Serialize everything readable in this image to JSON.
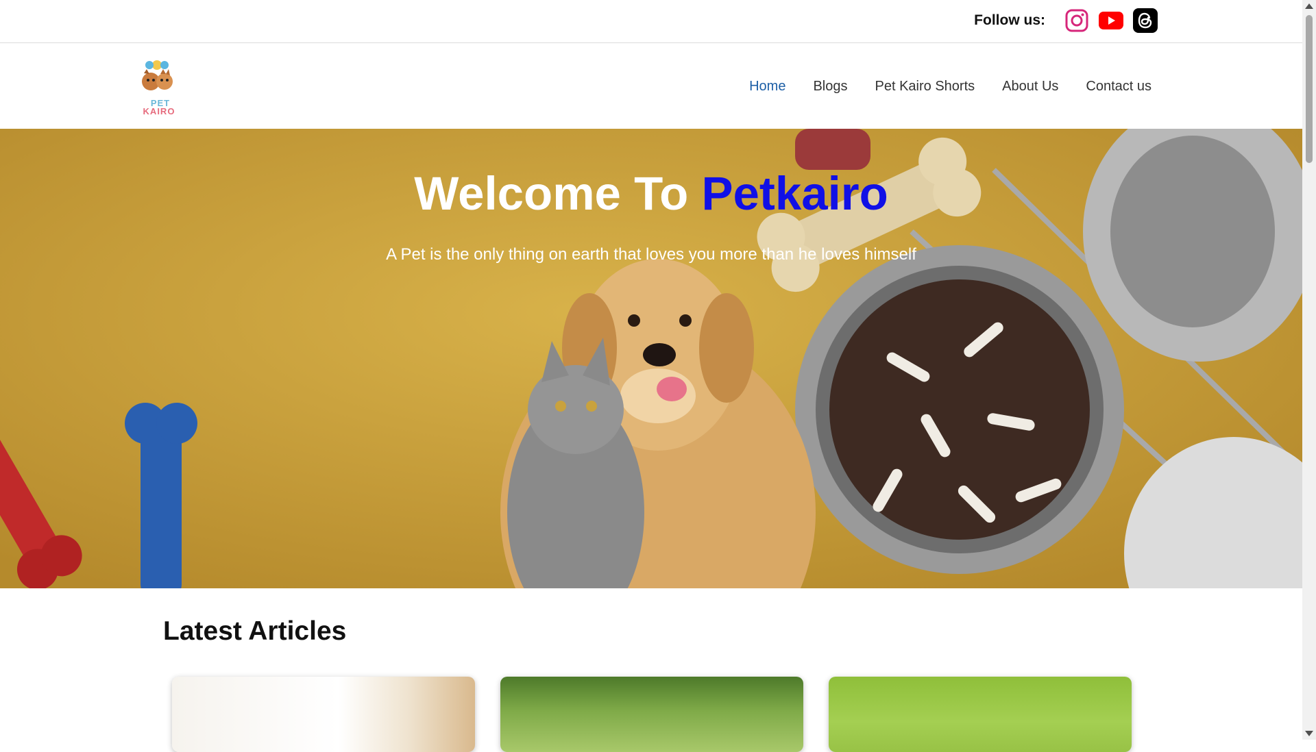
{
  "header": {
    "follow_label": "Follow us:",
    "socials": [
      {
        "name": "instagram-icon",
        "color": "#d6267a"
      },
      {
        "name": "youtube-icon",
        "color": "#ff0000"
      },
      {
        "name": "threads-icon",
        "color": "#000000"
      }
    ]
  },
  "logo": {
    "line1": "PET",
    "line2": "KAIRO"
  },
  "nav": {
    "items": [
      {
        "label": "Home",
        "active": true
      },
      {
        "label": "Blogs"
      },
      {
        "label": "Pet Kairo Shorts"
      },
      {
        "label": "About Us"
      },
      {
        "label": "Contact us"
      }
    ]
  },
  "hero": {
    "title_prefix": "Welcome To ",
    "title_brand": "Petkairo",
    "subtitle": "A Pet is the only thing on earth that loves you more than he loves himself"
  },
  "articles": {
    "title": "Latest Articles"
  },
  "colors": {
    "accent": "#1d5fa6",
    "brand": "#1010e6",
    "hero_bg": "#c9a13c"
  }
}
